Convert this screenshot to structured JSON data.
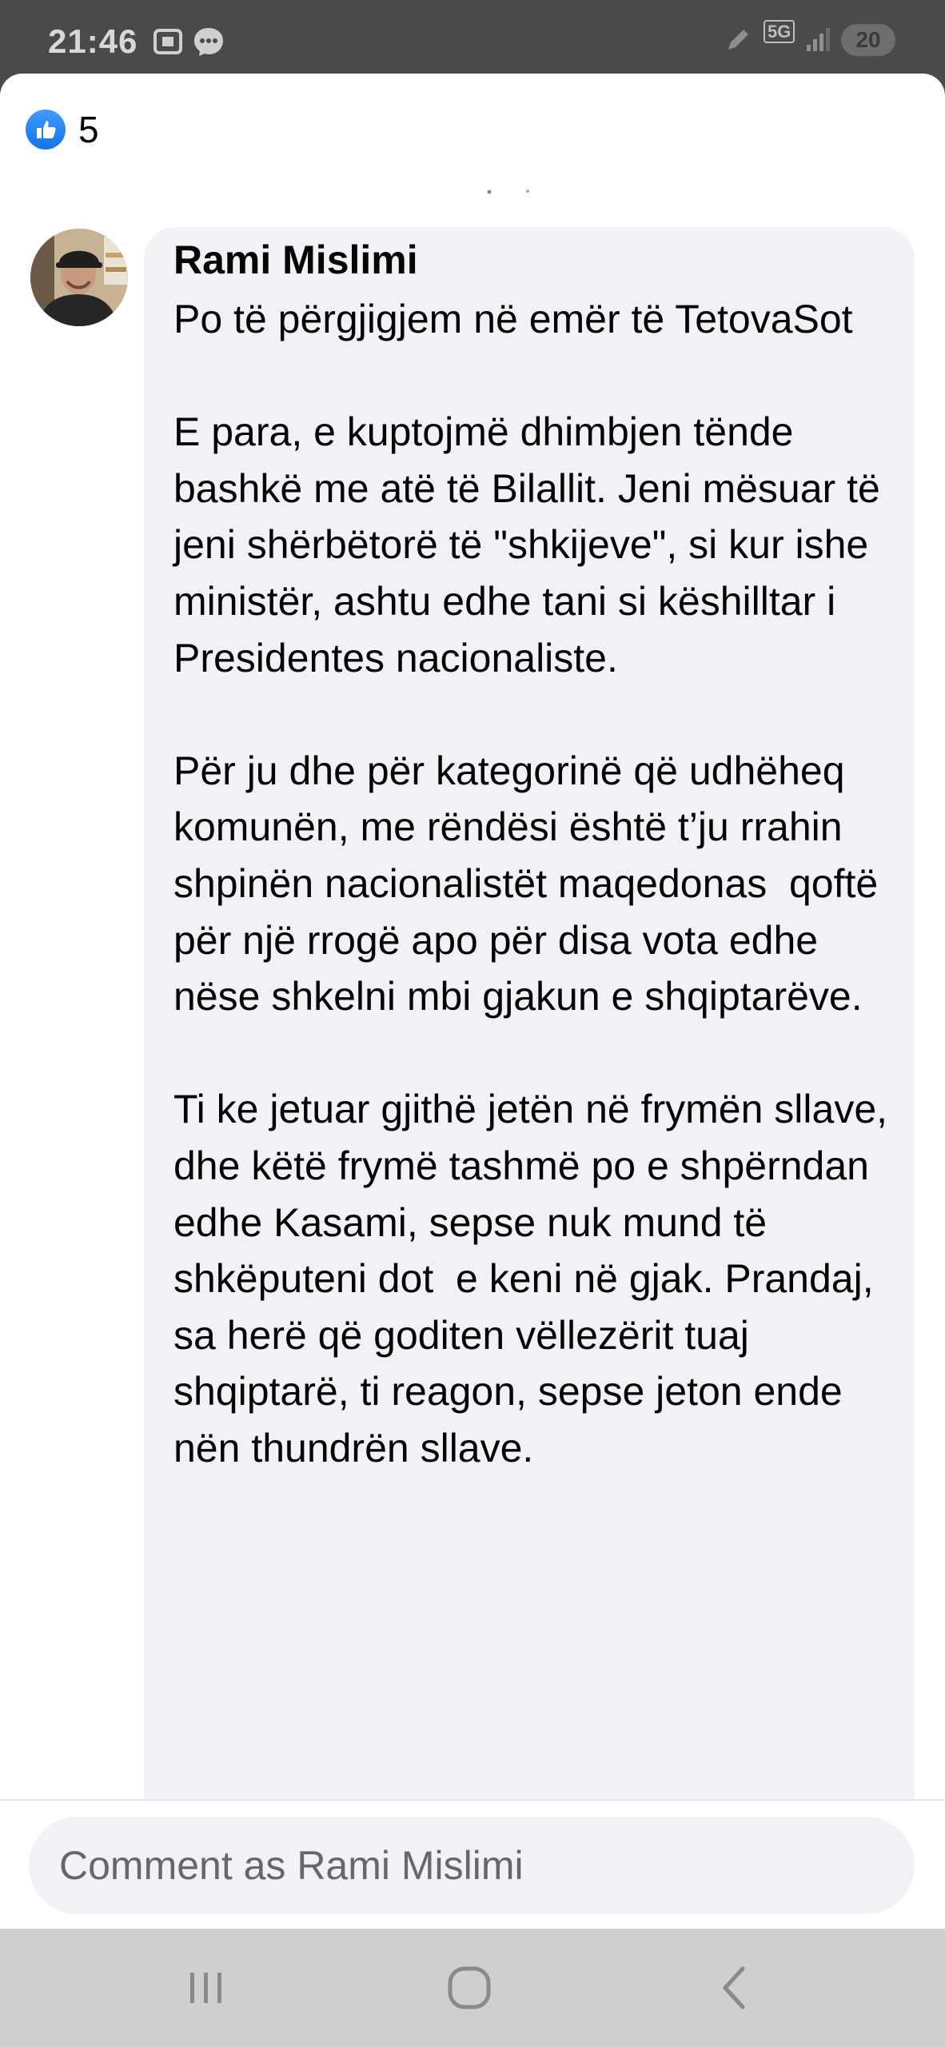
{
  "status_bar": {
    "time": "21:46",
    "network": "5G",
    "battery": "20",
    "icons": [
      "screenshot-icon",
      "messenger-icon",
      "pen-icon",
      "signal-icon",
      "battery-icon"
    ]
  },
  "reactions": {
    "icon": "like-icon",
    "count": "5"
  },
  "comment": {
    "author": "Rami Mislimi",
    "text": "Po të përgjigjem në emër të TetovaSot\n\nE para, e kuptojmë dhimbjen tënde bashkë me atë të Bilallit. Jeni mësuar të jeni shërbëtorë të \"shkijeve\", si kur ishe ministër, ashtu edhe tani si këshilltar i Presidentes nacionaliste.\n\nPër ju dhe për kategorinë që udhëheq komunën, me rëndësi është t’ju rrahin shpinën nacionalistët maqedonas  qoftë për një rrogë apo për disa vota edhe nëse shkelni mbi gjakun e shqiptarëve.\n\nTi ke jetuar gjithë jetën në frymën sllave, dhe këtë frymë tashmë po e shpërndan edhe Kasami, sepse nuk mund të shkëputeni dot  e keni në gjak. Prandaj, sa herë që goditen vëllezërit tuaj shqiptarë, ti reagon, sepse jeton ende nën thundrën sllave."
  },
  "composer": {
    "placeholder": "Comment as Rami Mislimi"
  },
  "nav": {
    "icons": [
      "recent-apps-icon",
      "home-icon",
      "back-icon"
    ]
  },
  "colors": {
    "accent": "#1877f2",
    "bubble": "#f0f2f5",
    "text": "#050505",
    "secondary_text": "#65676b"
  }
}
